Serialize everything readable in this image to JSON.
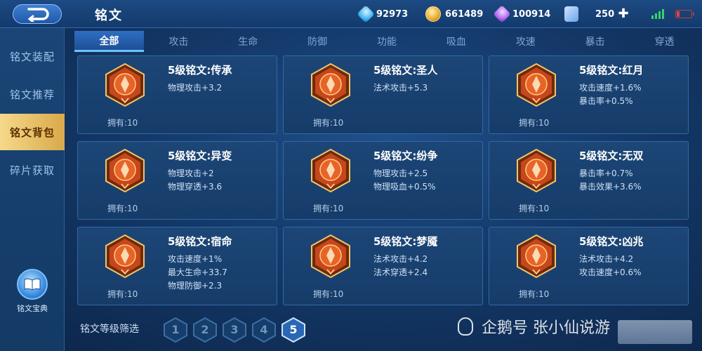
{
  "header": {
    "title": "铭文",
    "resources": [
      {
        "icon": "crystal-icon",
        "value": "92973"
      },
      {
        "icon": "gold-coin-icon",
        "value": "661489"
      },
      {
        "icon": "gem-icon",
        "value": "100914"
      },
      {
        "icon": "ticket-icon",
        "value": "250"
      }
    ]
  },
  "sidebar": {
    "items": [
      {
        "label": "铭文装配"
      },
      {
        "label": "铭文推荐"
      },
      {
        "label": "铭文背包"
      },
      {
        "label": "碎片获取"
      }
    ],
    "active_index": 2,
    "codex_label": "铭文宝典"
  },
  "tabs": [
    "全部",
    "攻击",
    "生命",
    "防御",
    "功能",
    "吸血",
    "攻速",
    "暴击",
    "穿透"
  ],
  "active_tab": 0,
  "cards": [
    {
      "name": "5级铭文:传承",
      "attrs": [
        "物理攻击+3.2"
      ],
      "owned": "拥有:10"
    },
    {
      "name": "5级铭文:圣人",
      "attrs": [
        "法术攻击+5.3"
      ],
      "owned": "拥有:10"
    },
    {
      "name": "5级铭文:红月",
      "attrs": [
        "攻击速度+1.6%",
        "暴击率+0.5%"
      ],
      "owned": "拥有:10"
    },
    {
      "name": "5级铭文:异变",
      "attrs": [
        "物理攻击+2",
        "物理穿透+3.6"
      ],
      "owned": "拥有:10"
    },
    {
      "name": "5级铭文:纷争",
      "attrs": [
        "物理攻击+2.5",
        "物理吸血+0.5%"
      ],
      "owned": "拥有:10"
    },
    {
      "name": "5级铭文:无双",
      "attrs": [
        "暴击率+0.7%",
        "暴击效果+3.6%"
      ],
      "owned": "拥有:10"
    },
    {
      "name": "5级铭文:宿命",
      "attrs": [
        "攻击速度+1%",
        "最大生命+33.7",
        "物理防御+2.3"
      ],
      "owned": "拥有:10"
    },
    {
      "name": "5级铭文:梦魇",
      "attrs": [
        "法术攻击+4.2",
        "法术穿透+2.4"
      ],
      "owned": "拥有:10"
    },
    {
      "name": "5级铭文:凶兆",
      "attrs": [
        "法术攻击+4.2",
        "攻击速度+0.6%"
      ],
      "owned": "拥有:10"
    }
  ],
  "level_filter": {
    "label": "铭文等级筛选",
    "levels": [
      "1",
      "2",
      "3",
      "4",
      "5"
    ],
    "active": "5"
  },
  "watermark": "企鹅号 张小仙说游"
}
